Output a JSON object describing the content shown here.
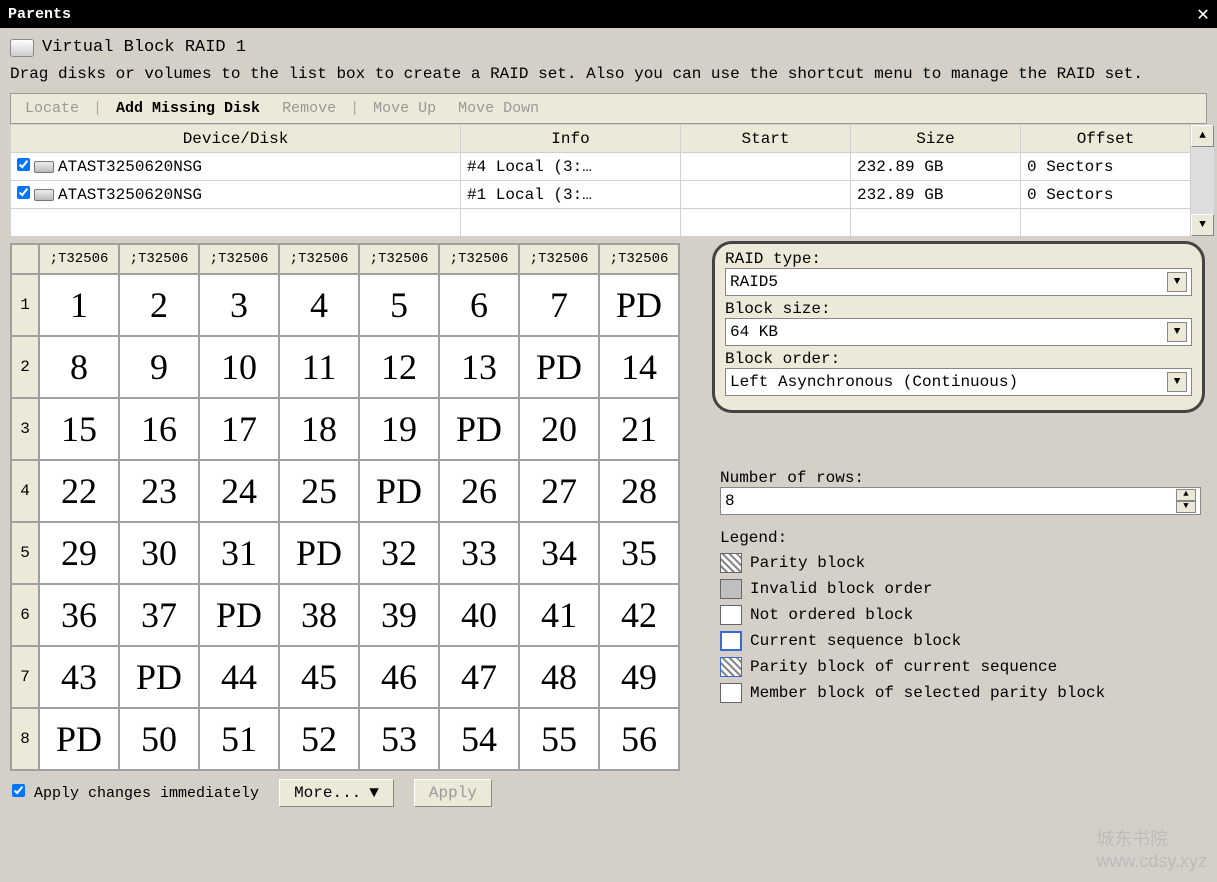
{
  "window": {
    "title": "Parents",
    "close": "✕"
  },
  "header": {
    "title": "Virtual Block RAID 1",
    "instructions": "Drag disks or volumes to the list box to create a RAID set. Also you can use the shortcut menu to manage the RAID set."
  },
  "toolbar": {
    "locate": "Locate",
    "add_missing": "Add Missing Disk",
    "remove": "Remove",
    "move_up": "Move Up",
    "move_down": "Move Down"
  },
  "table": {
    "columns": [
      "Device/Disk",
      "Info",
      "Start",
      "Size",
      "Offset"
    ],
    "rows": [
      {
        "checked": true,
        "name": "ATAST3250620NSG",
        "info": "#4 Local (3:…",
        "start": "",
        "size": "232.89 GB",
        "offset": "0 Sectors"
      },
      {
        "checked": true,
        "name": "ATAST3250620NSG",
        "info": "#1 Local (3:…",
        "start": "",
        "size": "232.89 GB",
        "offset": "0 Sectors"
      }
    ]
  },
  "grid": {
    "col_headers": [
      ";T32506",
      ";T32506",
      ";T32506",
      ";T32506",
      ";T32506",
      ";T32506",
      ";T32506",
      ";T32506"
    ],
    "rows": [
      [
        "1",
        "2",
        "3",
        "4",
        "5",
        "6",
        "7",
        "PD"
      ],
      [
        "8",
        "9",
        "10",
        "11",
        "12",
        "13",
        "PD",
        "14"
      ],
      [
        "15",
        "16",
        "17",
        "18",
        "19",
        "PD",
        "20",
        "21"
      ],
      [
        "22",
        "23",
        "24",
        "25",
        "PD",
        "26",
        "27",
        "28"
      ],
      [
        "29",
        "30",
        "31",
        "PD",
        "32",
        "33",
        "34",
        "35"
      ],
      [
        "36",
        "37",
        "PD",
        "38",
        "39",
        "40",
        "41",
        "42"
      ],
      [
        "43",
        "PD",
        "44",
        "45",
        "46",
        "47",
        "48",
        "49"
      ],
      [
        "PD",
        "50",
        "51",
        "52",
        "53",
        "54",
        "55",
        "56"
      ]
    ]
  },
  "form": {
    "raid_type_label": "RAID type:",
    "raid_type_value": "RAID5",
    "block_size_label": "Block size:",
    "block_size_value": "64 KB",
    "block_order_label": "Block order:",
    "block_order_value": "Left Asynchronous (Continuous)",
    "num_rows_label": "Number of rows:",
    "num_rows_value": "8"
  },
  "legend": {
    "title": "Legend:",
    "parity": "Parity block",
    "invalid": "Invalid block order",
    "not_ordered": "Not ordered block",
    "current": "Current sequence block",
    "parity_current": "Parity block of current sequence",
    "member": "Member block of selected parity block"
  },
  "bottom": {
    "apply_immediate": "Apply changes immediately",
    "more": "More...",
    "apply": "Apply"
  },
  "watermark": {
    "line1": "城东书院",
    "line2": "www.cdsy.xyz"
  }
}
